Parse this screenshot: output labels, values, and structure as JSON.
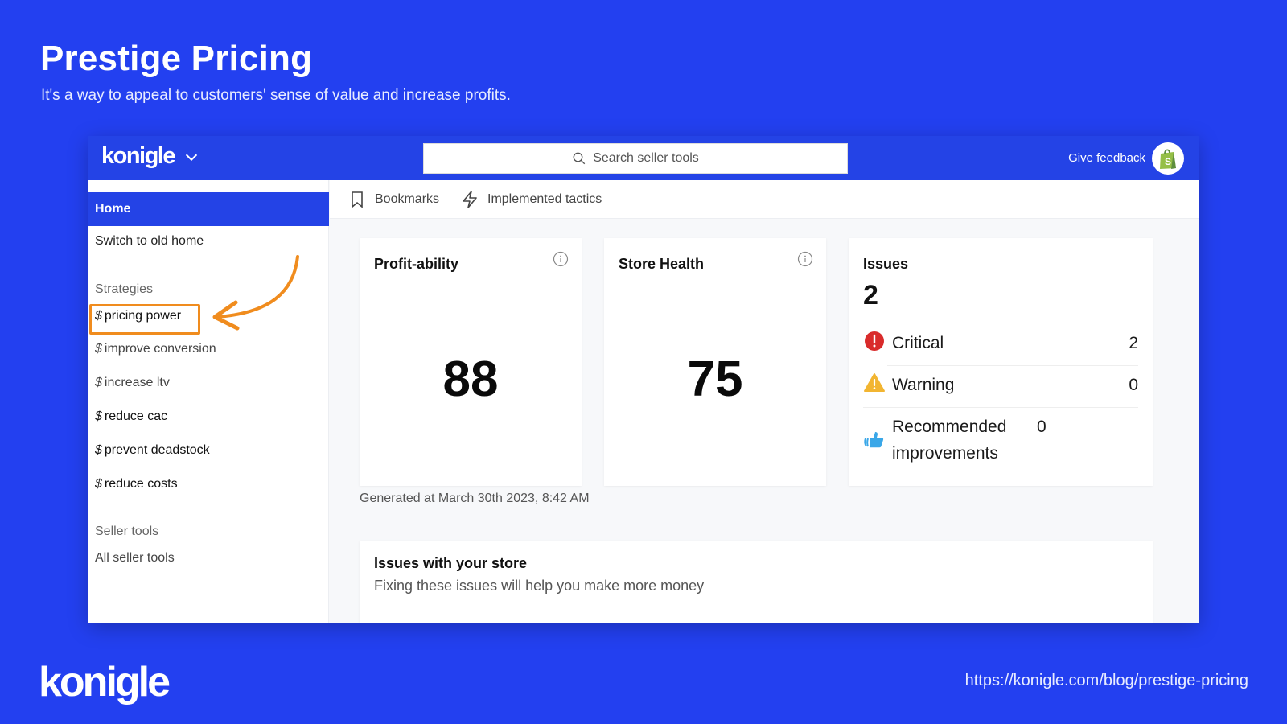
{
  "slide": {
    "title": "Prestige Pricing",
    "subtitle": "It's a way to appeal to customers' sense of value and increase profits.",
    "footer_logo": "konigle",
    "footer_url": "https://konigle.com/blog/prestige-pricing"
  },
  "app": {
    "logo": "konigle",
    "logo_icon": "chevron-down-icon",
    "search_placeholder": "Search seller tools",
    "search_icon": "search-icon",
    "feedback_label": "Give feedback",
    "avatar_icon": "shopify-bag-icon",
    "brand_color": "#2443e6",
    "highlight_color": "#f08c1e"
  },
  "sidebar": {
    "home": "Home",
    "switch_old": "Switch to old home",
    "strategies_heading": "Strategies",
    "strategies": [
      {
        "prefix": "$",
        "label": "pricing power",
        "highlighted": true
      },
      {
        "prefix": "$",
        "label": "improve conversion"
      },
      {
        "prefix": "$",
        "label": "increase ltv"
      },
      {
        "prefix": "$",
        "label": "reduce cac"
      },
      {
        "prefix": "$",
        "label": "prevent deadstock"
      },
      {
        "prefix": "$",
        "label": "reduce costs"
      }
    ],
    "seller_tools_heading": "Seller tools",
    "all_seller_tools": "All seller tools"
  },
  "tabs": [
    {
      "label": "Bookmarks",
      "icon": "bookmark-icon"
    },
    {
      "label": "Implemented tactics",
      "icon": "lightning-icon"
    }
  ],
  "cards": {
    "profitability": {
      "title": "Profit-ability",
      "value": "88"
    },
    "store_health": {
      "title": "Store Health",
      "value": "75"
    },
    "issues": {
      "title": "Issues",
      "total": "2",
      "rows": [
        {
          "label": "Critical",
          "value": "2",
          "icon": "critical-icon",
          "color": "#d92b2b"
        },
        {
          "label": "Warning",
          "value": "0",
          "icon": "warning-icon",
          "color": "#f2b531"
        },
        {
          "label": "Recommended improvements",
          "value": "0",
          "icon": "thumbs-up-icon",
          "color": "#3aa7e8"
        }
      ]
    }
  },
  "generated": "Generated at March 30th 2023, 8:42 AM",
  "issues_store": {
    "title": "Issues with your store",
    "subtitle": "Fixing these issues will help you make more money"
  }
}
